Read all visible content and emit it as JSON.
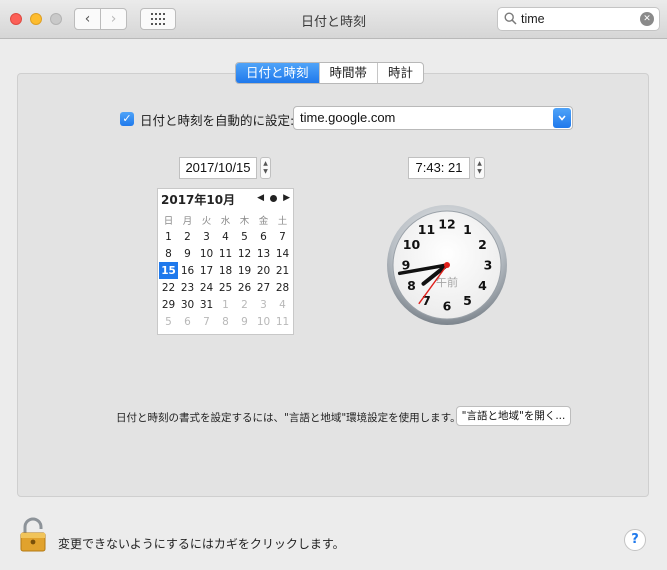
{
  "window": {
    "title": "日付と時刻"
  },
  "search": {
    "value": "time"
  },
  "tabs": [
    {
      "label": "日付と時刻",
      "active": true
    },
    {
      "label": "時間帯",
      "active": false
    },
    {
      "label": "時計",
      "active": false
    }
  ],
  "auto": {
    "label": "日付と時刻を自動的に設定:",
    "checked": true,
    "server": "time.google.com"
  },
  "date": {
    "value": "2017/10/15"
  },
  "time": {
    "value": "7:43: 21"
  },
  "calendar": {
    "title": "2017年10月",
    "weekdays": [
      "日",
      "月",
      "火",
      "水",
      "木",
      "金",
      "土"
    ],
    "weeks": [
      [
        "1",
        "2",
        "3",
        "4",
        "5",
        "6",
        "7"
      ],
      [
        "8",
        "9",
        "10",
        "11",
        "12",
        "13",
        "14"
      ],
      [
        "15",
        "16",
        "17",
        "18",
        "19",
        "20",
        "21"
      ],
      [
        "22",
        "23",
        "24",
        "25",
        "26",
        "27",
        "28"
      ],
      [
        "29",
        "30",
        "31",
        "1",
        "2",
        "3",
        "4"
      ],
      [
        "5",
        "6",
        "7",
        "8",
        "9",
        "10",
        "11"
      ]
    ],
    "selected": "15"
  },
  "clock": {
    "numbers": [
      "12",
      "1",
      "2",
      "3",
      "4",
      "5",
      "6",
      "7",
      "8",
      "9",
      "10",
      "11"
    ],
    "ampm": "午前",
    "hours": 7,
    "minutes": 43,
    "seconds": 21
  },
  "format_note": "日付と時刻の書式を設定するには、\"言語と地域\"環境設定を使用します。",
  "open_button": "\"言語と地域\"を開く...",
  "lock_text": "変更できないようにするにはカギをクリックします。",
  "help": "?",
  "colors": {
    "accent": "#1f79ec",
    "second_hand": "#e0201b"
  }
}
